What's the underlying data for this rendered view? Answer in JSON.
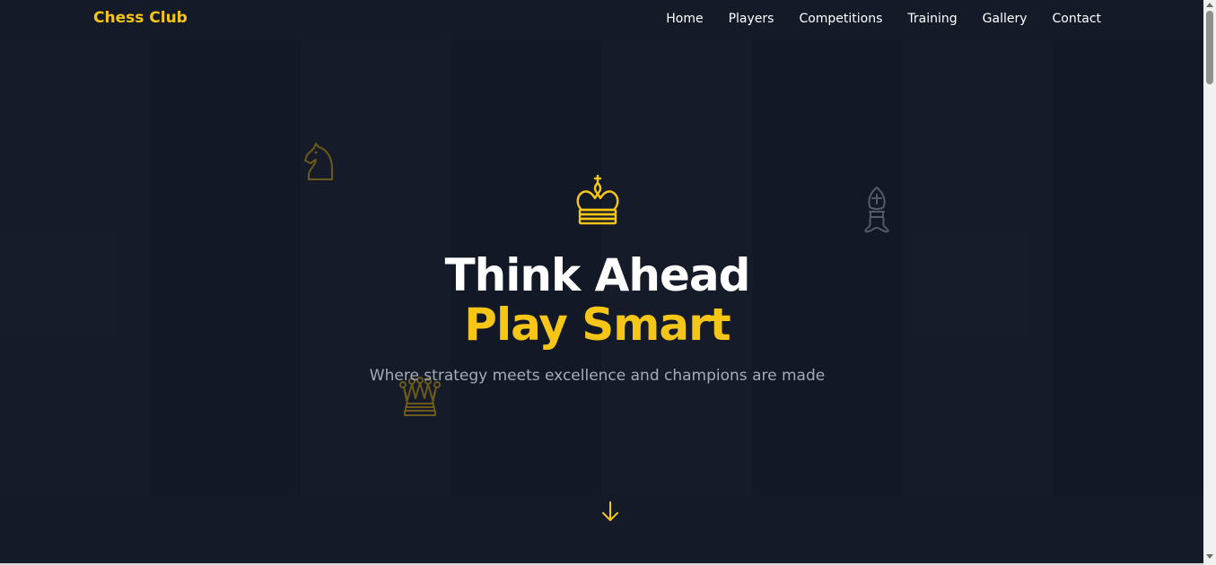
{
  "nav": {
    "brand": "Chess Club",
    "items": [
      {
        "label": "Home"
      },
      {
        "label": "Players"
      },
      {
        "label": "Competitions"
      },
      {
        "label": "Training"
      },
      {
        "label": "Gallery"
      },
      {
        "label": "Contact"
      }
    ]
  },
  "hero": {
    "icon": "crown-icon",
    "title_line1": "Think Ahead",
    "title_line2": "Play Smart",
    "subtitle": "Where strategy meets excellence and champions are made",
    "scroll_icon": "arrow-down-icon"
  },
  "decor": [
    "knight-icon",
    "bishop-icon",
    "queen-icon"
  ],
  "colors": {
    "background": "#141a28",
    "accent": "#f5c518",
    "text": "#ffffff",
    "muted": "#a5acb8"
  }
}
